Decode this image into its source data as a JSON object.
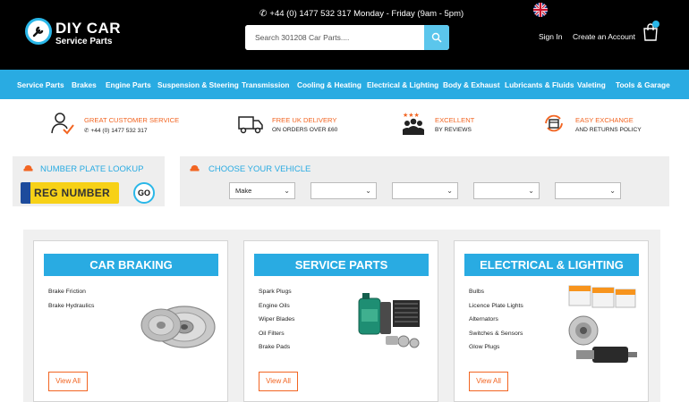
{
  "header": {
    "logo_title": "DIY CAR",
    "logo_subtitle": "Service Parts",
    "phone_text": "+44 (0) 1477 532 317 Monday - Friday (9am - 5pm)",
    "search_placeholder": "Search 301208 Car Parts....",
    "signin_label": "Sign In",
    "create_account_label": "Create an Account"
  },
  "nav": {
    "items": [
      "Service Parts",
      "Brakes",
      "Engine Parts",
      "Suspension & Steering",
      "Transmission",
      "Cooling & Heating",
      "Electrical & Lighting",
      "Body & Exhaust",
      "Lubricants & Fluids",
      "Valeting",
      "Tools & Garage"
    ]
  },
  "benefits": [
    {
      "title": "GREAT CUSTOMER SERVICE",
      "subtitle": "+44 (0) 1477 532 317",
      "icon": "customer-service-icon"
    },
    {
      "title": "FREE UK DELIVERY",
      "subtitle": "ON ORDERS OVER £60",
      "icon": "delivery-truck-icon"
    },
    {
      "title": "EXCELLENT",
      "subtitle": "BY REVIEWS",
      "icon": "reviews-icon"
    },
    {
      "title": "EASY EXCHANGE",
      "subtitle": "AND RETURNS POLICY",
      "icon": "exchange-icon"
    }
  ],
  "lookup": {
    "number_plate_title": "NUMBER PLATE LOOKUP",
    "reg_placeholder": "REG NUMBER",
    "go_label": "GO",
    "vehicle_title": "CHOOSE YOUR VEHICLE",
    "make_label": "Make"
  },
  "categories": [
    {
      "title": "CAR BRAKING",
      "links": [
        "Brake Friction",
        "Brake Hydraulics"
      ],
      "view_all": "View All"
    },
    {
      "title": "SERVICE PARTS",
      "links": [
        "Spark Plugs",
        "Engine Oils",
        "Wiper Blades",
        "Oil Filters",
        "Brake Pads"
      ],
      "view_all": "View All"
    },
    {
      "title": "ELECTRICAL & LIGHTING",
      "links": [
        "Bulbs",
        "Licence Plate Lights",
        "Alternators",
        "Switches & Sensors",
        "Glow Plugs"
      ],
      "view_all": "View All"
    }
  ],
  "colors": {
    "accent_blue": "#29abe2",
    "accent_orange": "#f26522",
    "header_bg": "#000000"
  }
}
